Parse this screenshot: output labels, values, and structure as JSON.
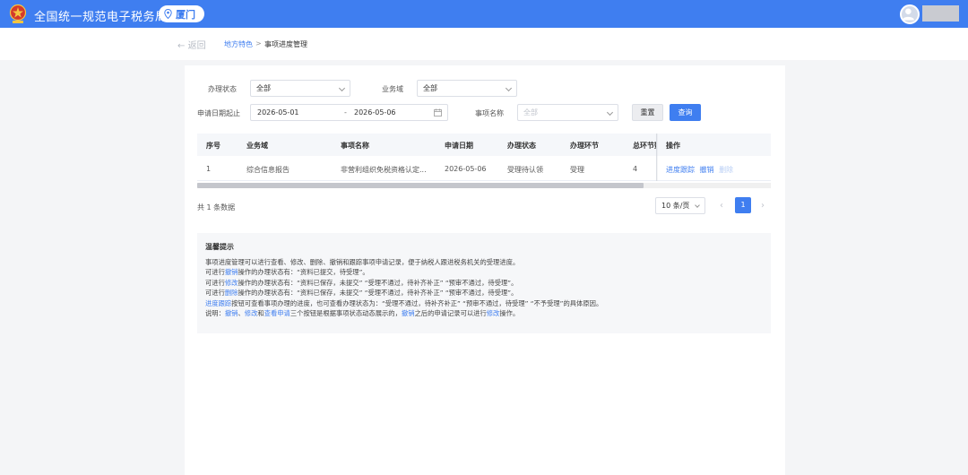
{
  "header": {
    "site_title": "全国统一规范电子税务局",
    "city": "厦门"
  },
  "breadcrumb": {
    "back": "返回",
    "level1": "地方特色",
    "separator": ">",
    "current": "事项进度管理"
  },
  "filters": {
    "status_label": "办理状态",
    "status_value": "全部",
    "domain_label": "业务域",
    "domain_value": "全部",
    "date_label": "申请日期起止",
    "date_start": "2026-05-01",
    "date_sep": "-",
    "date_end": "2026-05-06",
    "item_label": "事项名称",
    "item_placeholder": "全部",
    "reset": "重置",
    "query": "查询"
  },
  "table": {
    "headers": [
      "序号",
      "业务域",
      "事项名称",
      "申请日期",
      "办理状态",
      "办理环节",
      "总环节数",
      "操作"
    ],
    "rows": [
      {
        "index": "1",
        "domain": "综合信息报告",
        "item": "非营利组织免税资格认定...",
        "date": "2026-05-06",
        "status": "受理待认领",
        "step": "受理",
        "total": "4",
        "actions": [
          "进度跟踪",
          "撤销",
          "删除"
        ]
      }
    ]
  },
  "pagination": {
    "total_text": "共 1 条数据",
    "page_size": "10 条/页",
    "prev": "‹",
    "current_page": "1",
    "next": "›"
  },
  "tips": {
    "title": "温馨提示",
    "line1": "事项进度管理可以进行查看、修改、删除、撤销和跟踪事项申请记录，便于纳税人跟进税务机关的受理进度。",
    "line2_pre": "可进行",
    "line2_link": "撤销",
    "line2_post": "操作的办理状态有：“资料已提交，待受理”。",
    "line3_pre": "可进行",
    "line3_link": "修改",
    "line3_post": "操作的办理状态有：“资料已保存，未提交”  “受理不通过，待补齐补正”  “预审不通过，待受理”。",
    "line4_pre": "可进行",
    "line4_link": "删除",
    "line4_post": "操作的办理状态有：“资料已保存，未提交”  “受理不通过，待补齐补正”  “预审不通过，待受理”。",
    "line5_link": "进度跟踪",
    "line5_post": "按钮可查看事项办理的进度，也可查看办理状态为：“受理不通过，待补齐补正”  “预审不通过，待受理”  “不予受理”的具体原因。",
    "line6_pre": "说明：",
    "line6_link1": "撤销",
    "line6_sep1": "、",
    "line6_link2": "修改",
    "line6_mid": "和",
    "line6_link3": "查看申请",
    "line6_mid2": "三个按钮是根据事项状态动态展示的，",
    "line6_link4": "撤销",
    "line6_mid3": "之后的申请记录可以进行",
    "line6_link5": "修改",
    "line6_post": "操作。"
  },
  "colors": {
    "primary": "#3f7ef0",
    "page_bg": "#f4f5f7"
  },
  "icons": {
    "logo": "tax-emblem-icon",
    "city": "location-pin-icon",
    "avatar": "user-avatar-icon",
    "back": "arrow-left-icon",
    "calendar": "calendar-icon"
  }
}
